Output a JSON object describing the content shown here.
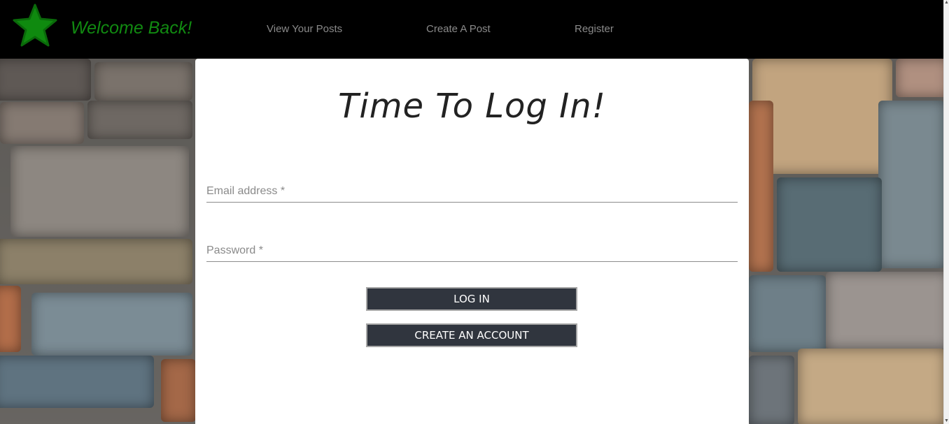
{
  "header": {
    "brand": "Welcome Back!",
    "nav": [
      {
        "label": "View Your Posts"
      },
      {
        "label": "Create A Post"
      },
      {
        "label": "Register"
      }
    ],
    "colors": {
      "background": "#000000",
      "brand": "#118a11",
      "link": "#8a8a8a"
    }
  },
  "login": {
    "title": "Time To Log In!",
    "email_placeholder": "Email address *",
    "password_placeholder": "Password *",
    "login_button": "LOG IN",
    "create_account_button": "CREATE AN ACCOUNT"
  },
  "colors": {
    "button_bg": "#30353e",
    "button_border": "#a6a6a6",
    "card_bg": "#ffffff"
  },
  "icons": {
    "logo": "star-icon"
  }
}
